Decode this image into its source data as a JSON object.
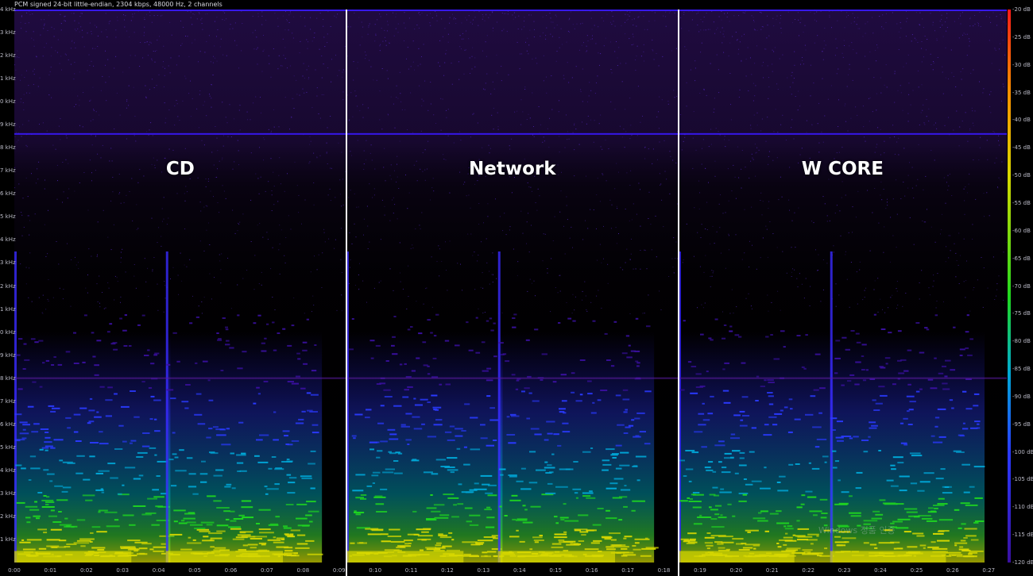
{
  "info_text": "PCM signed 24-bit little-endian, 2304 kbps, 48000 Hz, 2 channels",
  "panels": [
    {
      "label": "CD"
    },
    {
      "label": "Network"
    },
    {
      "label": "W CORE"
    }
  ],
  "chart_data": {
    "type": "heatmap",
    "title": "",
    "xlabel": "",
    "ylabel": "",
    "x_unit": "m:ss",
    "x_ticks": [
      "0:00",
      "0:01",
      "0:02",
      "0:03",
      "0:04",
      "0:05",
      "0:06",
      "0:07",
      "0:08",
      "0:09",
      "0:10",
      "0:11",
      "0:12",
      "0:13",
      "0:14",
      "0:15",
      "0:16",
      "0:17",
      "0:18",
      "0:19",
      "0:20",
      "0:21",
      "0:22",
      "0:23",
      "0:24",
      "0:25",
      "0:26",
      "0:27"
    ],
    "xlim": [
      "0:00",
      "0:27.5"
    ],
    "y_unit": "kHz",
    "y_ticks": [
      {
        "value": 24,
        "label": "4 kHz"
      },
      {
        "value": 23,
        "label": "3 kHz"
      },
      {
        "value": 22,
        "label": "2 kHz"
      },
      {
        "value": 21,
        "label": "1 kHz"
      },
      {
        "value": 20,
        "label": "0 kHz"
      },
      {
        "value": 19,
        "label": "9 kHz"
      },
      {
        "value": 18,
        "label": "8 kHz"
      },
      {
        "value": 17,
        "label": "7 kHz"
      },
      {
        "value": 16,
        "label": "6 kHz"
      },
      {
        "value": 15,
        "label": "5 kHz"
      },
      {
        "value": 14,
        "label": "4 kHz"
      },
      {
        "value": 13,
        "label": "3 kHz"
      },
      {
        "value": 12,
        "label": "2 kHz"
      },
      {
        "value": 11,
        "label": "1 kHz"
      },
      {
        "value": 10,
        "label": "0 kHz"
      },
      {
        "value": 9,
        "label": "9 kHz"
      },
      {
        "value": 8,
        "label": "8 kHz"
      },
      {
        "value": 7,
        "label": "7 kHz"
      },
      {
        "value": 6,
        "label": "6 kHz"
      },
      {
        "value": 5,
        "label": "5 kHz"
      },
      {
        "value": 4,
        "label": "4 kHz"
      },
      {
        "value": 3,
        "label": "3 kHz"
      },
      {
        "value": 2,
        "label": "2 kHz"
      },
      {
        "value": 1,
        "label": "1 kHz"
      }
    ],
    "ylim": [
      0,
      24
    ],
    "colorbar": {
      "unit": "dB",
      "range": [
        -120,
        -20
      ],
      "ticks": [
        "-20 dB",
        "-25 dB",
        "-30 dB",
        "-35 dB",
        "-40 dB",
        "-45 dB",
        "-50 dB",
        "-55 dB",
        "-60 dB",
        "-65 dB",
        "-70 dB",
        "-75 dB",
        "-80 dB",
        "-85 dB",
        "-90 dB",
        "-95 dB",
        "-100 dB",
        "-105 dB",
        "-110 dB",
        "-115 dB",
        "-120 dB"
      ],
      "colors": [
        "#ff1a1a",
        "#ff8a00",
        "#d8d800",
        "#1fd81f",
        "#00a8d8",
        "#2a3aff",
        "#3a10a0"
      ]
    },
    "segments": [
      {
        "label": "CD",
        "t_start": 0.0,
        "t_end": 9.2
      },
      {
        "label": "Network",
        "t_start": 9.2,
        "t_end": 18.4
      },
      {
        "label": "W CORE",
        "t_start": 18.4,
        "t_end": 27.5
      }
    ],
    "notes_onsets_within_segment_s": [
      0.0,
      4.2
    ],
    "horizontal_lines_khz": [
      24,
      18.6,
      8
    ]
  },
  "watermark": "Windows 정품 인증"
}
